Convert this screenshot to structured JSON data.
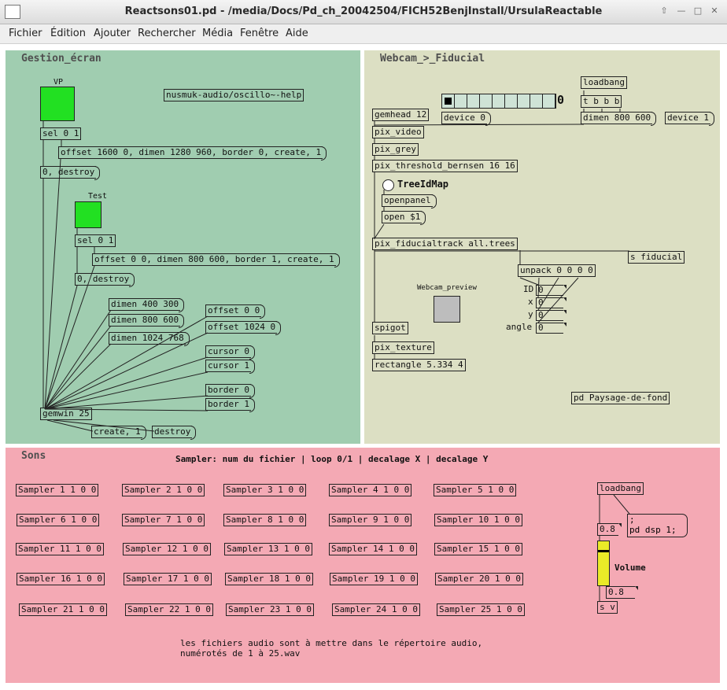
{
  "window": {
    "title": "Reactsons01.pd  - /media/Docs/Pd_ch_20042504/FICH52BenjInstall/UrsulaReactable"
  },
  "menu": [
    "Fichier",
    "Édition",
    "Ajouter",
    "Rechercher",
    "Média",
    "Fenêtre",
    "Aide"
  ],
  "colors": {
    "panel_green": "#a0cdb0",
    "panel_beige": "#dcdfc3",
    "panel_pink": "#f4a9b4",
    "bang_green": "#22e022",
    "slider_yellow": "#eaea28"
  },
  "gestion": {
    "title": "Gestion_écran",
    "vp_label": "VP",
    "test_label": "Test",
    "help": "nusmuk-audio/oscillo~-help",
    "sel1": "sel 0 1",
    "offset1": "offset 1600 0, dimen 1280 960, border 0, create, 1",
    "destroy1": "0, destroy",
    "sel2": "sel 0 1",
    "offset2": "offset 0 0, dimen 800 600, border 1, create, 1",
    "destroy2": "0, destroy",
    "dimen400": "dimen 400 300",
    "dimen800": "dimen 800 600",
    "dimen1024": "dimen 1024 768",
    "offset00": "offset 0 0",
    "offset1024": "offset 1024 0",
    "cursor0": "cursor 0",
    "cursor1": "cursor 1",
    "border0": "border 0",
    "border1": "border 1",
    "gemwin": "gemwin 25",
    "create": "create, 1",
    "destroy": "destroy"
  },
  "webcam": {
    "title": "Webcam_>_Fiducial",
    "loadbang": "loadbang",
    "tbbb": "t b b b",
    "radio_value": "0",
    "gemhead": "gemhead 12",
    "device0": "device 0",
    "dimen": "dimen 800 600",
    "device1": "device 1",
    "pix_video": "pix_video",
    "pix_grey": "pix_grey",
    "pix_threshold": "pix_threshold_bernsen 16 16",
    "treeidmap": "TreeIdMap",
    "openpanel": "openpanel",
    "open": "open $1",
    "pix_fiducial": "pix_fiducialtrack all.trees",
    "s_fiducial": "s fiducial",
    "unpack": "unpack 0 0 0 0",
    "preview_label": "Webcam_preview",
    "id_label": "ID",
    "x_label": "x",
    "y_label": "y",
    "angle_label": "angle",
    "id_val": "0",
    "x_val": "0",
    "y_val": "0",
    "angle_val": "0",
    "spigot": "spigot",
    "pix_texture": "pix_texture",
    "rectangle": "rectangle 5.334 4",
    "paysage": "pd Paysage-de-fond"
  },
  "sons": {
    "title": "Sons",
    "header": "Sampler: num du fichier | loop 0/1 | decalage X | decalage Y",
    "samplers": [
      "Sampler 1 1 0 0",
      "Sampler 2 1 0 0",
      "Sampler 3 1 0 0",
      "Sampler 4 1 0 0",
      "Sampler 5 1 0 0",
      "Sampler 6 1 0 0",
      "Sampler 7 1 0 0",
      "Sampler 8 1 0 0",
      "Sampler 9 1 0 0",
      "Sampler 10 1 0 0",
      "Sampler 11 1 0 0",
      "Sampler 12 1 0 0",
      "Sampler 13 1 0 0",
      "Sampler 14 1 0 0",
      "Sampler 15 1 0 0",
      "Sampler 16 1 0 0",
      "Sampler 17 1 0 0",
      "Sampler 18 1 0 0",
      "Sampler 19 1 0 0",
      "Sampler 20 1 0 0",
      "Sampler 21 1 0 0",
      "Sampler 22 1 0 0",
      "Sampler 23 1 0 0",
      "Sampler 24 1 0 0",
      "Sampler 25 1 0 0"
    ],
    "loadbang": "loadbang",
    "atom08": "0.8",
    "dsp_line1": ";",
    "dsp_line2": "pd dsp 1;",
    "volume_label": "Volume",
    "volume_value": 0.8,
    "atom08b": "0.8",
    "sv": "s v",
    "note1": "les fichiers audio sont à mettre dans le répertoire audio,",
    "note2": "numérotés de 1 à 25.wav"
  }
}
